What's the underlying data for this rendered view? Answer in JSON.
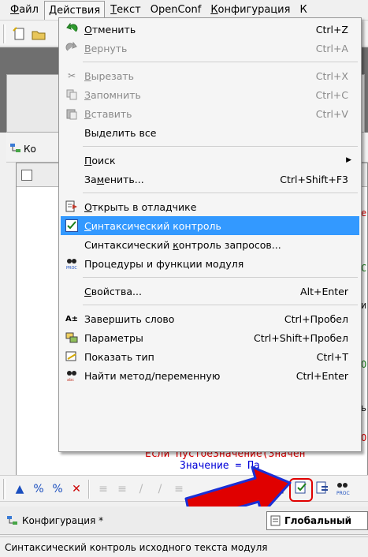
{
  "menubar": {
    "items": [
      {
        "pre": "",
        "u": "Ф",
        "post": "айл"
      },
      {
        "pre": "",
        "u": "Д",
        "post": "ействия"
      },
      {
        "pre": "",
        "u": "Т",
        "post": "екст"
      },
      {
        "pre": "",
        "u": "",
        "post": "OpenConf"
      },
      {
        "pre": "",
        "u": "К",
        "post": "онфигурация"
      },
      {
        "pre": "",
        "u": "",
        "post": "К"
      }
    ]
  },
  "menu": {
    "items": [
      {
        "pre": "",
        "u": "О",
        "post": "тменить",
        "shortcut": "Ctrl+Z",
        "icon": "undo-icon"
      },
      {
        "pre": "",
        "u": "В",
        "post": "ернуть",
        "shortcut": "Ctrl+A",
        "icon": "redo-icon"
      },
      {
        "pre": "",
        "u": "В",
        "post": "ырезать",
        "shortcut": "Ctrl+X",
        "icon": "cut-icon"
      },
      {
        "pre": "",
        "u": "З",
        "post": "апомнить",
        "shortcut": "Ctrl+C",
        "icon": "copy-icon"
      },
      {
        "pre": "",
        "u": "В",
        "post": "ставить",
        "shortcut": "Ctrl+V",
        "icon": "paste-icon"
      },
      {
        "pre": "Выделить все",
        "u": "",
        "post": "",
        "shortcut": "",
        "icon": ""
      },
      {
        "pre": "",
        "u": "П",
        "post": "оиск",
        "shortcut": "",
        "icon": ""
      },
      {
        "pre": "За",
        "u": "м",
        "post": "енить...",
        "shortcut": "Ctrl+Shift+F3",
        "icon": ""
      },
      {
        "pre": "",
        "u": "О",
        "post": "ткрыть в отладчике",
        "shortcut": "",
        "icon": "open-debugger-icon"
      },
      {
        "pre": "",
        "u": "С",
        "post": "интаксический контроль",
        "shortcut": "",
        "icon": "syntax-check-icon"
      },
      {
        "pre": "Синтаксический ",
        "u": "к",
        "post": "онтроль запросов...",
        "shortcut": "",
        "icon": ""
      },
      {
        "pre": "Процедуры и функции модуля",
        "u": "",
        "post": "",
        "shortcut": "",
        "icon": "procedures-icon"
      },
      {
        "pre": "",
        "u": "С",
        "post": "войства...",
        "shortcut": "Alt+Enter",
        "icon": ""
      },
      {
        "pre": "Завершить слово",
        "u": "",
        "post": "",
        "shortcut": "Ctrl+Пробел",
        "icon": "complete-word-icon"
      },
      {
        "pre": "Параметры",
        "u": "",
        "post": "",
        "shortcut": "Ctrl+Shift+Пробел",
        "icon": "parameters-icon"
      },
      {
        "pre": "Показать тип",
        "u": "",
        "post": "",
        "shortcut": "Ctrl+T",
        "icon": "show-type-icon"
      },
      {
        "pre": "Найти метод/переменную",
        "u": "",
        "post": "",
        "shortcut": "Ctrl+Enter",
        "icon": "find-method-icon"
      }
    ]
  },
  "workspace": {
    "doc_tab_fragment": "Ко",
    "code_line_1": "Если ПустоеЗначение(Значен",
    "code_line_2": "Значение = Па",
    "right_fragments": [
      "е",
      "С",
      "и",
      "О",
      "ь",
      "О"
    ]
  },
  "tabs": {
    "configuration": "Конфигурация *",
    "global": "Глобальный"
  },
  "status": {
    "text": "Синтаксический контроль исходного текста модуля"
  },
  "colors": {
    "highlight": "#3399ff",
    "arrow": "#e00000",
    "arrow_outline": "#1a2fd6"
  }
}
